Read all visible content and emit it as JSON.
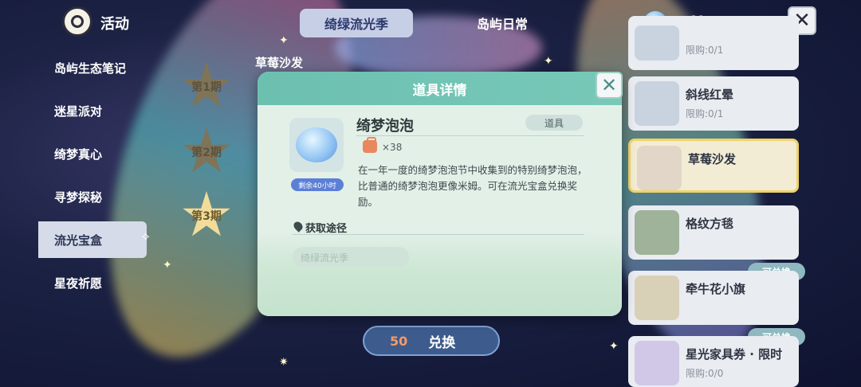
{
  "header": {
    "title": "活动",
    "tabs": [
      "绮绿流光季",
      "岛屿日常"
    ],
    "currency_count": "38"
  },
  "sidebar": {
    "items": [
      "岛屿生态笔记",
      "迷星派对",
      "绮梦真心",
      "寻梦探秘",
      "流光宝盒",
      "星夜祈愿"
    ],
    "active_index": 4
  },
  "periods": [
    "第1期",
    "第2期",
    "第3期"
  ],
  "section_title": "草莓沙发",
  "items": [
    {
      "name": "",
      "limit": "限购:0/1"
    },
    {
      "name": "斜线红晕",
      "limit": "限购:0/1"
    },
    {
      "name": "草莓沙发",
      "limit": ""
    },
    {
      "name": "格纹方毯",
      "limit": ""
    },
    {
      "name": "牵牛花小旗",
      "limit": "",
      "badge": "可兑换"
    },
    {
      "name": "星光家具券 · 限时",
      "limit": "限购:0/0",
      "badge": "可兑换"
    }
  ],
  "exchange": {
    "price": "50",
    "label": "兑换"
  },
  "modal": {
    "title": "道具详情",
    "item_name": "绮梦泡泡",
    "item_type": "道具",
    "owned": "×38",
    "remaining": "剩余40小时",
    "description": "在一年一度的绮梦泡泡节中收集到的特别绮梦泡泡，比普通的绮梦泡泡更像米姆。可在流光宝盒兑换奖励。",
    "source_label": "获取途径",
    "source_button": "绮绿流光季"
  }
}
